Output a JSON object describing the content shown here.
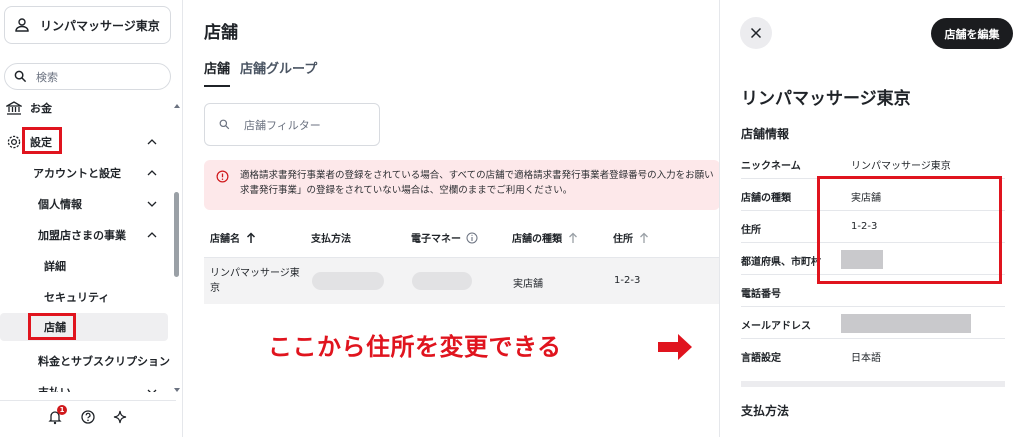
{
  "account": {
    "name": "リンパマッサージ東京"
  },
  "search": {
    "placeholder": "検索"
  },
  "sidebar": {
    "items": [
      {
        "label": "お金"
      },
      {
        "label": "設定"
      },
      {
        "label": "アカウントと設定"
      },
      {
        "label": "個人情報"
      },
      {
        "label": "加盟店さまの事業"
      },
      {
        "label": "詳細"
      },
      {
        "label": "セキュリティ"
      },
      {
        "label": "店舗"
      },
      {
        "label": "料金とサブスクリプション"
      },
      {
        "label": "支払い"
      }
    ],
    "notification_count": "1"
  },
  "main": {
    "title": "店舗",
    "tabs": [
      {
        "label": "店舗"
      },
      {
        "label": "店舗グループ"
      }
    ],
    "filter_placeholder": "店舗フィルター",
    "alert_line1": "適格請求書発行事業者の登録をされている場合、すべての店舗で適格請求書発行事業者登録番号の入力をお願い",
    "alert_line2": "求書発行事業」の登録をされていない場合は、空欄のままでご利用ください。",
    "columns": [
      "店舗名",
      "支払方法",
      "電子マネー",
      "店舗の種類",
      "住所"
    ],
    "row": {
      "name_line1": "リンパマッサージ東",
      "name_line2": "京",
      "type": "実店舗",
      "address": "1-2-3"
    }
  },
  "annotation": {
    "text": "ここから住所を変更できる"
  },
  "panel": {
    "edit_label": "店舗を編集",
    "store_name": "リンパマッサージ東京",
    "section_info": "店舗情報",
    "rows": [
      {
        "key": "ニックネーム",
        "value": "リンパマッサージ東京"
      },
      {
        "key": "店舗の種類",
        "value": "実店舗"
      },
      {
        "key": "住所",
        "value": "1-2-3"
      },
      {
        "key": "都道府県、市町村",
        "value": ""
      },
      {
        "key": "電話番号",
        "value": ""
      },
      {
        "key": "メールアドレス",
        "value": ""
      },
      {
        "key": "言語設定",
        "value": "日本語"
      }
    ],
    "section_payment": "支払方法"
  }
}
